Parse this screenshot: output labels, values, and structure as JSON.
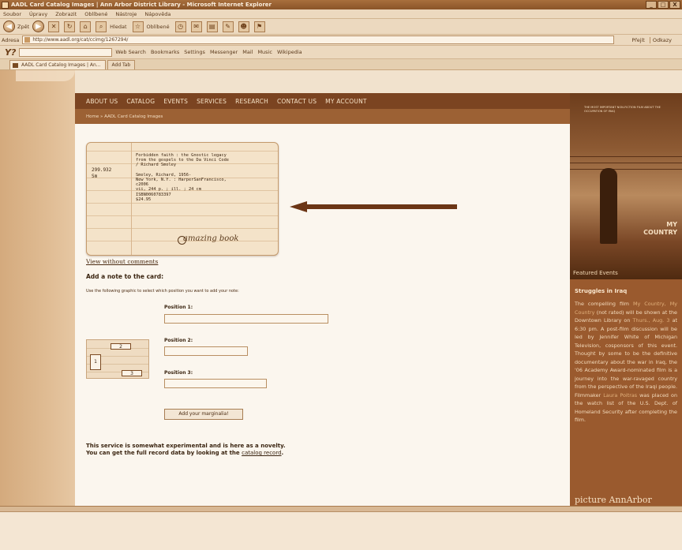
{
  "window": {
    "title": "AADL Card Catalog Images | Ann Arbor District Library - Microsoft Internet Explorer",
    "buttons": [
      "_",
      "□",
      "X"
    ]
  },
  "menu": [
    "Soubor",
    "Úpravy",
    "Zobrazit",
    "Oblíbené",
    "Nástroje",
    "Nápověda"
  ],
  "toolbar": {
    "back_label": "Zpět",
    "search_label": "Hledat",
    "favorites_label": "Oblíbené"
  },
  "address": {
    "label": "Adresa",
    "url": "http://www.aadl.org/cat/ccimg/1267294/",
    "go_label": "Přejít",
    "links_label": "Odkazy"
  },
  "yahoo": {
    "logo": "Y?",
    "items": [
      "Web Search",
      "Bookmarks",
      "Settings",
      "Messenger",
      "Mail",
      "Music",
      "Wikipedia"
    ]
  },
  "tabs": [
    {
      "label": "AADL Card Catalog Images | An..."
    },
    {
      "label": "Add Tab"
    }
  ],
  "nav": [
    "ABOUT US",
    "CATALOG",
    "EVENTS",
    "SERVICES",
    "RESEARCH",
    "CONTACT US",
    "MY ACCOUNT"
  ],
  "breadcrumb": "Home » AADL Card Catalog Images",
  "card": {
    "call_number": "299.932\nSm",
    "text": "Forbidden faith : the Gnostic legacy\nfrom the gospels to the Da Vinci Code\n/ Richard Smoley\n\nSmoley, Richard, 1956-\nNew York, N.Y. : HarperSanFrancisco,\nc2006\nvii, 244 p. ; ill. ; 24 cm\nISBN0060783397\n$24.95",
    "handwritten_note": "amazing book"
  },
  "view_link": "View without comments",
  "add_note_heading": "Add a note to the card:",
  "instructions": "Use the following graphic to select which position you want to add your note:",
  "positions": [
    {
      "label": "Position 1:"
    },
    {
      "label": "Position 2:"
    },
    {
      "label": "Position 3:"
    }
  ],
  "graphic_labels": [
    "2",
    "1",
    "3"
  ],
  "submit_label": "Add your marginalia!",
  "footnote": {
    "line1": "This service is somewhat experimental and is here as a novelty.",
    "line2_pre": "You can get the full record data by looking at the",
    "link": "catalog record",
    "line2_post": "."
  },
  "sidebar": {
    "poster_tagline": "The most important non-fiction film about the occupation of Iraq",
    "movie_title": "MY\nCOUNTRY",
    "poster_subtitle": "MY COUNTRY",
    "featured_label": "Featured Events",
    "event_title": "Struggles in Iraq",
    "event_body_1": "The compelling film",
    "event_link_film": "My Country, My Country",
    "event_body_2": "(not rated) will be shown at the Downtown Library on",
    "event_link_date": "Thurs., Aug. 3",
    "event_body_3": "at 6:30 pm. A post-film discussion will be led by Jennifer White of Michigan Television, cosponsors of this event. Thought by some to be the definitive documentary about the war in Iraq, the '06 Academy Award-nominated film is a journey into the war-ravaged country from the perspective of the Iraqi people. Filmmaker",
    "event_link_person": "Laura Poitras",
    "event_body_4": "was placed on the watch list of the U.S. Dept. of Homeland Security after completing the film.",
    "brand": "picture AnnArbor"
  },
  "colors": {
    "nav_bg": "#7b4421",
    "sidebar_bg": "#9a5a2e",
    "arrow": "#6b3515"
  }
}
